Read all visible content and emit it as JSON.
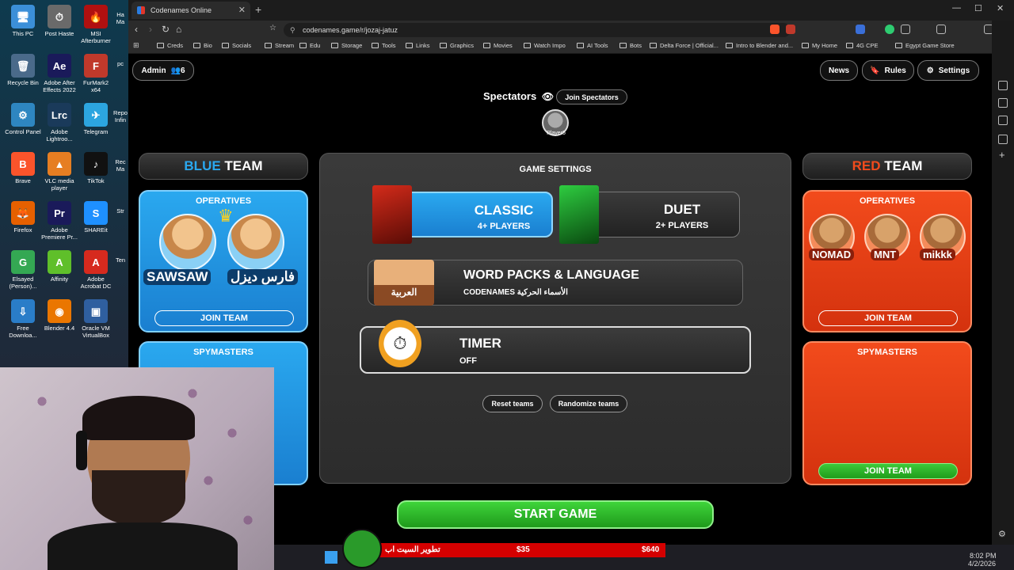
{
  "desktop": {
    "icons": [
      {
        "label": "This PC",
        "glyph": "🖥",
        "color": "#3b8fd8"
      },
      {
        "label": "Post Haste",
        "glyph": "⏱",
        "color": "#6a6a6a"
      },
      {
        "label": "MSI Afterburner",
        "glyph": "🔥",
        "color": "#b01010"
      },
      {
        "label": "Recycle Bin",
        "glyph": "🗑",
        "color": "#4a6a8a"
      },
      {
        "label": "Adobe After Effects 2022",
        "glyph": "Ae",
        "color": "#1a1a5a"
      },
      {
        "label": "FurMark2 x64",
        "glyph": "F",
        "color": "#c0392b"
      },
      {
        "label": "Control Panel",
        "glyph": "⚙",
        "color": "#2e86c1"
      },
      {
        "label": "Adobe Lightroo...",
        "glyph": "Lrc",
        "color": "#1a3a5a"
      },
      {
        "label": "Telegram",
        "glyph": "✈",
        "color": "#2ca5e0"
      },
      {
        "label": "Brave",
        "glyph": "B",
        "color": "#fb542b"
      },
      {
        "label": "VLC media player",
        "glyph": "▲",
        "color": "#e67e22"
      },
      {
        "label": "TikTok",
        "glyph": "♪",
        "color": "#111"
      },
      {
        "label": "Firefox",
        "glyph": "🦊",
        "color": "#e66000"
      },
      {
        "label": "Adobe Premiere Pr...",
        "glyph": "Pr",
        "color": "#1a1a5a"
      },
      {
        "label": "SHAREit",
        "glyph": "S",
        "color": "#1e90ff"
      },
      {
        "label": "Elsayed (Person)...",
        "glyph": "G",
        "color": "#34a853"
      },
      {
        "label": "Affinity",
        "glyph": "A",
        "color": "#5fbf2a"
      },
      {
        "label": "Adobe Acrobat DC",
        "glyph": "A",
        "color": "#d62a1e"
      },
      {
        "label": "Free Downloa...",
        "glyph": "⇩",
        "color": "#2a7dc8"
      },
      {
        "label": "Blender 4.4",
        "glyph": "◉",
        "color": "#ea7600"
      },
      {
        "label": "Oracle VM VirtualBox",
        "glyph": "▣",
        "color": "#2f5f9f"
      }
    ],
    "side_labels": [
      "Ha Ma",
      "pc",
      "Repo Infin",
      "Rec Ma",
      "Str",
      "Ten"
    ]
  },
  "browser": {
    "tab_title": "Codenames Online",
    "url": "codenames.game/r/jozaj-jatuz",
    "bookmarks": [
      "Creds",
      "Bio",
      "Socials",
      "Stream",
      "Edu",
      "Storage",
      "Tools",
      "Links",
      "Graphics",
      "Movies",
      "Watch Impo",
      "AI Tools",
      "Bots",
      "Delta Force | Official...",
      "Intro to Blender and...",
      "My Home",
      "4G CPE",
      "Egypt Game Store"
    ]
  },
  "game": {
    "admin_label": "Admin",
    "player_count": "6",
    "news_label": "News",
    "rules_label": "Rules",
    "settings_label": "Settings",
    "spectators_label": "Spectators",
    "join_spectators_label": "Join Spectators",
    "spectator_name": "Player5",
    "blue_team": {
      "word1": "BLUE",
      "word2": "TEAM",
      "operatives_label": "OPERATIVES",
      "players": [
        "SAWSAW",
        "فارس ديزل"
      ],
      "join_label": "JOIN TEAM",
      "spymasters_label": "SPYMASTERS"
    },
    "red_team": {
      "word1": "RED",
      "word2": "TEAM",
      "operatives_label": "OPERATIVES",
      "players": [
        "NOMAD",
        "MNT",
        "mikkk"
      ],
      "join_label": "JOIN TEAM",
      "spymasters_label": "SPYMASTERS",
      "spymasters_join_label": "JOIN TEAM"
    },
    "settings": {
      "title": "GAME SETTINGS",
      "classic_title": "CLASSIC",
      "classic_sub": "4+ PLAYERS",
      "duet_title": "DUET",
      "duet_sub": "2+ PLAYERS",
      "wordpacks_title": "WORD PACKS & LANGUAGE",
      "wordpacks_sub": "CODENAMES الأسماء الحركية",
      "language_badge": "العربية",
      "timer_title": "TIMER",
      "timer_sub": "OFF",
      "reset_label": "Reset teams",
      "randomize_label": "Randomize teams"
    },
    "start_label": "START GAME"
  },
  "overlay": {
    "ticker_text": "تطوير السيت اب",
    "ticker_amount1": "$35",
    "ticker_amount2": "$640"
  },
  "tray": {
    "time": "8:02 PM",
    "date": "4/2/2026"
  },
  "colors": {
    "blue_accent": "#2aa8ef",
    "red_accent": "#f24b1c",
    "green_button": "#2fb82a"
  }
}
